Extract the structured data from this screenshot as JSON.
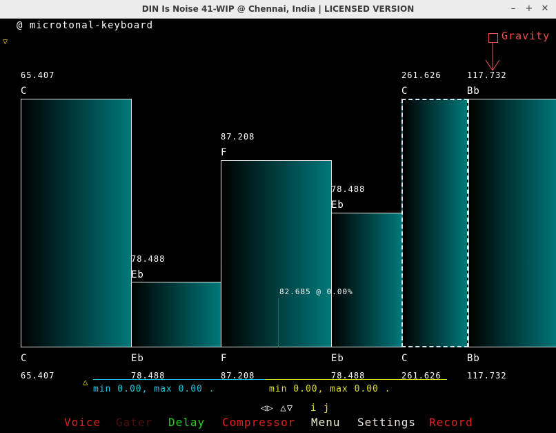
{
  "window": {
    "title": "DIN Is Noise 41-WIP @ Chennai, India | LICENSED VERSION",
    "controls": [
      "–",
      "+",
      "✕"
    ]
  },
  "instrument": {
    "label": "@ microtonal-keyboard"
  },
  "gravity": {
    "label": "Gravity"
  },
  "keys_top": [
    {
      "freq": "65.407",
      "note": "C"
    },
    {
      "freq": "78.488",
      "note": "Eb"
    },
    {
      "freq": "87.208",
      "note": "F"
    },
    {
      "freq": "78.488",
      "note": "Eb"
    },
    {
      "freq": "261.626",
      "note": "C"
    },
    {
      "freq": "117.732",
      "note": "Bb"
    }
  ],
  "keys_bottom": [
    {
      "note": "C",
      "freq": "65.407"
    },
    {
      "note": "Eb",
      "freq": "78.488"
    },
    {
      "note": "F",
      "freq": "87.208"
    },
    {
      "note": "Eb",
      "freq": "78.488"
    },
    {
      "note": "C",
      "freq": "261.626"
    },
    {
      "note": "Bb",
      "freq": "117.732"
    }
  ],
  "cursor_readout": "82.685 @ 0.00%",
  "range_left": "min 0.00, max 0.00 .",
  "range_right": "min 0.00, max 0.00 .",
  "nav_hint_arrows": "◁▷ △▽",
  "nav_hint_keys": "i j",
  "menu": {
    "voice": "Voice",
    "gater": "Gater",
    "delay": "Delay",
    "compressor": "Compressor",
    "menu": "Menu",
    "settings": "Settings",
    "record": "Record"
  },
  "colors": {
    "voice": "#e02020",
    "gater": "#4a1010",
    "delay": "#20d020",
    "compressor": "#e02020",
    "menu": "#f0f0d0",
    "settings": "#f0e8e0",
    "record": "#e02020",
    "gravity": "#f05050",
    "range_left": "#20c8e0",
    "range_right": "#e0e020",
    "nav_hint": "#ffffff",
    "nav_keys": "#e0e020"
  }
}
